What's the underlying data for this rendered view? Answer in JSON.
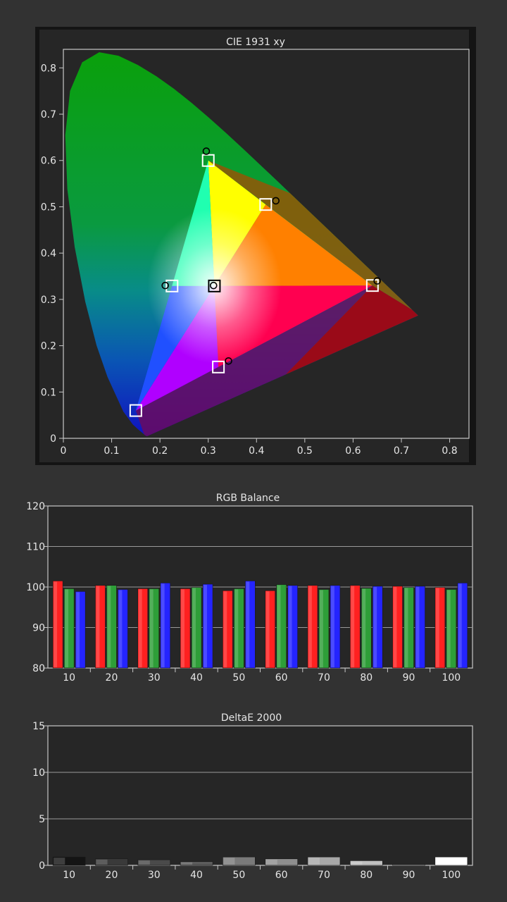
{
  "colors": {
    "page_bg": "#323232",
    "plot_bg": "#262626",
    "frame": "#c8c8c8",
    "red": "#ff2020",
    "green": "#2e9e38",
    "blue": "#2424ff"
  },
  "charts": {
    "cie": {
      "title": "CIE 1931 xy",
      "x_ticks": [
        "0",
        "0.1",
        "0.2",
        "0.3",
        "0.4",
        "0.5",
        "0.6",
        "0.7",
        "0.8"
      ],
      "y_ticks": [
        "0",
        "0.1",
        "0.2",
        "0.3",
        "0.4",
        "0.5",
        "0.6",
        "0.7",
        "0.8"
      ]
    },
    "rgb": {
      "title": "RGB Balance",
      "y_ticks": [
        "80",
        "90",
        "100",
        "110",
        "120"
      ],
      "categories": [
        "10",
        "20",
        "30",
        "40",
        "50",
        "60",
        "70",
        "80",
        "90",
        "100"
      ]
    },
    "de": {
      "title": "DeltaE 2000",
      "y_ticks": [
        "0",
        "5",
        "10",
        "15"
      ],
      "categories": [
        "10",
        "20",
        "30",
        "40",
        "50",
        "60",
        "70",
        "80",
        "90",
        "100"
      ]
    }
  },
  "chart_data": [
    {
      "type": "scatter",
      "title": "CIE 1931 xy",
      "xlabel": "",
      "ylabel": "",
      "xlim": [
        0,
        0.84
      ],
      "ylim": [
        0,
        0.84
      ],
      "grid": false,
      "targets": [
        {
          "x": 0.64,
          "y": 0.33
        },
        {
          "x": 0.3,
          "y": 0.6
        },
        {
          "x": 0.15,
          "y": 0.06
        },
        {
          "x": 0.3127,
          "y": 0.329
        },
        {
          "x": 0.225,
          "y": 0.329
        },
        {
          "x": 0.321,
          "y": 0.154
        },
        {
          "x": 0.419,
          "y": 0.505
        }
      ],
      "measured": [
        {
          "x": 0.65,
          "y": 0.34
        },
        {
          "x": 0.296,
          "y": 0.62
        },
        {
          "x": 0.311,
          "y": 0.33
        },
        {
          "x": 0.211,
          "y": 0.33
        },
        {
          "x": 0.342,
          "y": 0.167
        },
        {
          "x": 0.44,
          "y": 0.513
        }
      ]
    },
    {
      "type": "bar",
      "title": "RGB Balance",
      "categories": [
        "10",
        "20",
        "30",
        "40",
        "50",
        "60",
        "70",
        "80",
        "90",
        "100"
      ],
      "ylim": [
        80,
        120
      ],
      "grid": true,
      "series": [
        {
          "color": "#ff2020",
          "values": [
            101.5,
            100.4,
            99.6,
            99.6,
            99.1,
            99.1,
            100.4,
            100.4,
            100.2,
            99.9
          ]
        },
        {
          "color": "#2e9e38",
          "values": [
            99.6,
            100.4,
            99.6,
            99.9,
            99.6,
            100.6,
            99.4,
            99.7,
            99.9,
            99.4
          ]
        },
        {
          "color": "#2424ff",
          "values": [
            98.9,
            99.4,
            101.0,
            100.7,
            101.5,
            100.4,
            100.4,
            100.2,
            100.2,
            101.0
          ]
        }
      ]
    },
    {
      "type": "bar",
      "title": "DeltaE 2000",
      "categories": [
        "10",
        "20",
        "30",
        "40",
        "50",
        "60",
        "70",
        "80",
        "90",
        "100"
      ],
      "ylim": [
        0,
        15
      ],
      "grid": true,
      "values": [
        0.9,
        0.7,
        0.6,
        0.4,
        0.9,
        0.7,
        0.9,
        0.5,
        0.05,
        0.9
      ],
      "bar_colors": [
        "#141414",
        "#3a3a3a",
        "#4a4a4a",
        "#5c5c5c",
        "#7a7a7a",
        "#8e8e8e",
        "#a8a8a8",
        "#c0c0c0",
        "#dadada",
        "#ffffff"
      ]
    }
  ]
}
